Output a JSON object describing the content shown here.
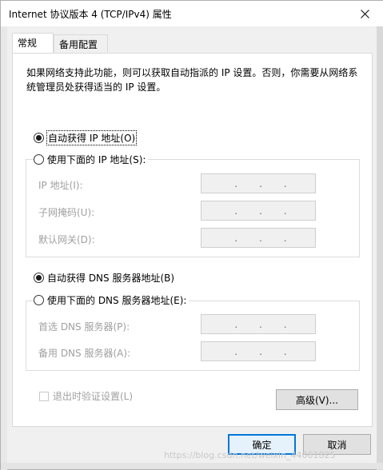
{
  "window": {
    "title": "Internet 协议版本 4 (TCP/IPv4) 属性"
  },
  "tabs": [
    {
      "label": "常规",
      "active": true
    },
    {
      "label": "备用配置",
      "active": false
    }
  ],
  "intro_text": "如果网络支持此功能，则可以获取自动指派的 IP 设置。否则，你需要从网络系统管理员处获得适当的 IP 设置。",
  "ip_section": {
    "auto_label": "自动获得 IP 地址(O)",
    "manual_label": "使用下面的 IP 地址(S):",
    "selected": "auto",
    "fields": [
      {
        "label": "IP 地址(I):",
        "value": ".    .    ."
      },
      {
        "label": "子网掩码(U):",
        "value": ".    .    ."
      },
      {
        "label": "默认网关(D):",
        "value": ".    .    ."
      }
    ]
  },
  "dns_section": {
    "auto_label": "自动获得 DNS 服务器地址(B)",
    "manual_label": "使用下面的 DNS 服务器地址(E):",
    "selected": "auto",
    "fields": [
      {
        "label": "首选 DNS 服务器(P):",
        "value": ".    .    ."
      },
      {
        "label": "备用 DNS 服务器(A):",
        "value": ".    .    ."
      }
    ]
  },
  "validate_checkbox": {
    "label": "退出时验证设置(L)",
    "checked": false,
    "enabled": false
  },
  "buttons": {
    "advanced": "高级(V)...",
    "ok": "确定",
    "cancel": "取消"
  },
  "watermark": "https://blog.csdn.net/weixin_44061825",
  "icons": {
    "close": "close-icon"
  }
}
